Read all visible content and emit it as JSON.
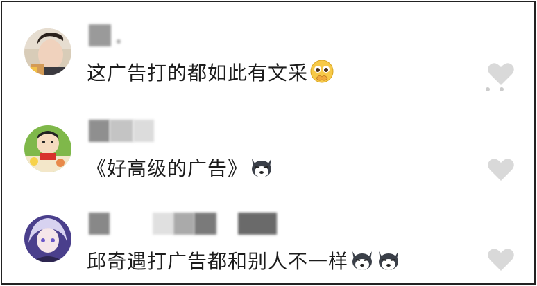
{
  "comments": [
    {
      "text": "这广告打的都如此有文采",
      "emoji": "pleading-face-emoji",
      "avatar": "young-man-avatar",
      "colors": {
        "bg": "#c8b79a",
        "accent": "#3a2a22"
      }
    },
    {
      "text": "《好高级的广告》",
      "emoji": "husky-dog-emoji",
      "avatar": "crayon-shinchan-avatar",
      "colors": {
        "bg": "#7fb84a",
        "accent": "#f6d24a"
      }
    },
    {
      "text": "邱奇遇打广告都和别人不一样",
      "emoji": "husky-dog-emoji-x2",
      "avatar": "anime-girl-avatar",
      "colors": {
        "bg": "#5a4ea0",
        "accent": "#d7d2f0"
      }
    }
  ],
  "icons": {
    "like": "heart-icon"
  },
  "colors": {
    "heart": "#d9d9d9",
    "text": "#1c1c1c",
    "border": "#222222"
  }
}
